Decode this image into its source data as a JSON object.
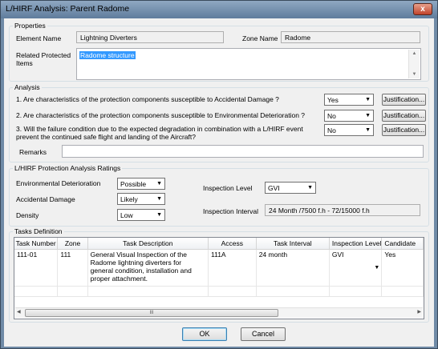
{
  "window": {
    "title": "L/HIRF Analysis: Parent Radome",
    "close_glyph": "x"
  },
  "properties": {
    "group_title": "Properties",
    "element_name_label": "Element Name",
    "element_name_value": "Lightning Diverters",
    "zone_name_label": "Zone Name",
    "zone_name_value": "Radome",
    "related_label": "Related Protected Items",
    "related_value": "Radome structure"
  },
  "analysis": {
    "group_title": "Analysis",
    "questions": [
      {
        "text": "1. Are characteristics of the protection components susceptible to Accidental Damage ?",
        "answer": "Yes",
        "button": "Justification..."
      },
      {
        "text": "2. Are characteristics of the protection components susceptible to  Environmental Deterioration ?",
        "answer": "No",
        "button": "Justification..."
      },
      {
        "text": "3. Will the failure condition due to the expected degradation in combination with a L/HIRF event prevent the continued safe flight and landing of the Aircraft?",
        "answer": "No",
        "button": "Justification..."
      }
    ],
    "remarks_label": "Remarks",
    "remarks_value": ""
  },
  "ratings": {
    "group_title": "L/HIRF Protection Analysis Ratings",
    "env_label": "Environmental Deterioration",
    "env_value": "Possible",
    "acc_label": "Accidental Damage",
    "acc_value": "Likely",
    "den_label": "Density",
    "den_value": "Low",
    "insp_level_label": "Inspection Level",
    "insp_level_value": "GVI",
    "insp_interval_label": "Inspection Interval",
    "insp_interval_value": "24 Month /7500 f.h - 72/15000 f.h"
  },
  "tasks": {
    "group_title": "Tasks Definition",
    "columns": [
      "Task Number",
      "Zone",
      "Task Description",
      "Access",
      "Task Interval",
      "Inspection Level",
      "Candidate"
    ],
    "rows": [
      [
        "111-01",
        "111",
        "General Visual Inspection of the Radome lightning diverters for general condition, installation and proper attachment.",
        "111A",
        "24 month",
        "GVI",
        "Yes"
      ]
    ],
    "scroll_grip": "III"
  },
  "footer": {
    "ok": "OK",
    "cancel": "Cancel"
  },
  "icons": {
    "dropdown": "chevron-down-icon",
    "scroll_up": "scroll-up-arrow-icon",
    "scroll_down": "scroll-down-arrow-icon"
  },
  "colors": {
    "title_bar": "#6f8aa6",
    "selection": "#3399ff",
    "dialog_bg": "#f0f0f0"
  }
}
